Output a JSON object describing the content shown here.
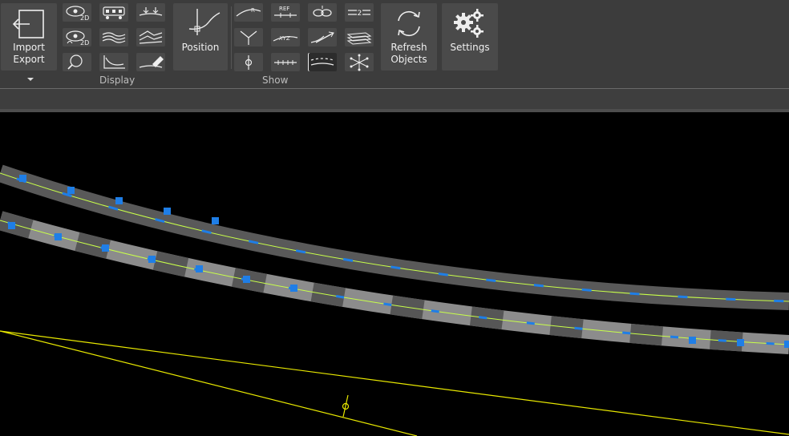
{
  "ribbon": {
    "import_export": {
      "line1": "Import",
      "line2": "Export"
    },
    "position": {
      "label": "Position"
    },
    "refresh": {
      "line1": "Refresh",
      "line2": "Objects"
    },
    "settings": {
      "label": "Settings"
    },
    "groups": {
      "display": "Display",
      "show": "Show"
    },
    "display_icons": [
      "eye-2d-icon",
      "vehicle-icon",
      "arrows-converge-icon",
      "eye-2d-alt-icon",
      "wavy-lines-icon",
      "layered-terrain-icon",
      "zoom-lens-icon",
      "curve-axis-icon",
      "eraser-pen-icon"
    ],
    "show_icons": [
      "radius-curve-icon",
      "ref-line-icon",
      "link-chain-icon",
      "equals-two-icon",
      "junction-y-icon",
      "xyz-line-icon",
      "arrow-curve-icon",
      "stacked-planes-icon",
      "circle-axis-icon",
      "tick-line-icon",
      "dashed-lane-icon",
      "star-burst-icon"
    ],
    "small_icon_text": {
      "dim_2d": "2D",
      "dim_2d_b": "2D",
      "ref": "REF",
      "xyz": "XYZ",
      "two": "2",
      "r": "R"
    }
  },
  "colors": {
    "ribbon_bg": "#3c3c3c",
    "button_bg": "#4a4a4a",
    "road_dark": "#595959",
    "road_light": "#8c8c8c",
    "centerline": "#c8ff4a",
    "marker": "#1f7ee6",
    "reference_line": "#e8e800"
  }
}
